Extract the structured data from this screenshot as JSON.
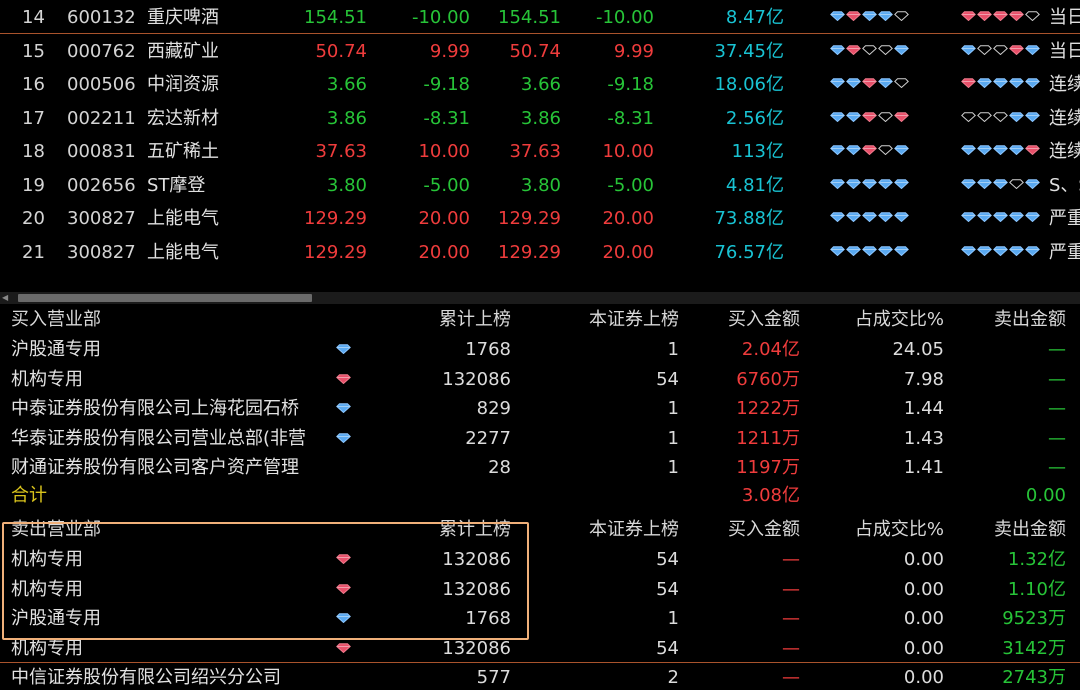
{
  "stock_rows": [
    {
      "idx": "14",
      "code": "600132",
      "name": "重庆啤酒",
      "v1": "154.51",
      "v2": "-10.00",
      "v3": "154.51",
      "v4": "-10.00",
      "dir": "green",
      "amount": "8.47亿",
      "d1": [
        "b",
        "r",
        "b",
        "b",
        "o"
      ],
      "d2": [
        "r",
        "r",
        "r",
        "r",
        "o"
      ],
      "note": "当日"
    },
    {
      "idx": "15",
      "code": "000762",
      "name": "西藏矿业",
      "v1": "50.74",
      "v2": "9.99",
      "v3": "50.74",
      "v4": "9.99",
      "dir": "red",
      "amount": "37.45亿",
      "d1": [
        "b",
        "r",
        "o",
        "o",
        "b"
      ],
      "d2": [
        "b",
        "o",
        "o",
        "r",
        "b"
      ],
      "note": "当日"
    },
    {
      "idx": "16",
      "code": "000506",
      "name": "中润资源",
      "v1": "3.66",
      "v2": "-9.18",
      "v3": "3.66",
      "v4": "-9.18",
      "dir": "green",
      "amount": "18.06亿",
      "d1": [
        "b",
        "b",
        "r",
        "b",
        "o"
      ],
      "d2": [
        "r",
        "b",
        "b",
        "b",
        "b"
      ],
      "note": "连续"
    },
    {
      "idx": "17",
      "code": "002211",
      "name": "宏达新材",
      "v1": "3.86",
      "v2": "-8.31",
      "v3": "3.86",
      "v4": "-8.31",
      "dir": "green",
      "amount": "2.56亿",
      "d1": [
        "b",
        "b",
        "r",
        "o",
        "r"
      ],
      "d2": [
        "o",
        "o",
        "o",
        "b",
        "b"
      ],
      "note": "连续"
    },
    {
      "idx": "18",
      "code": "000831",
      "name": "五矿稀土",
      "v1": "37.63",
      "v2": "10.00",
      "v3": "37.63",
      "v4": "10.00",
      "dir": "red",
      "amount": "113亿",
      "d1": [
        "b",
        "b",
        "r",
        "o",
        "b"
      ],
      "d2": [
        "b",
        "b",
        "b",
        "b",
        "r"
      ],
      "note": "连续"
    },
    {
      "idx": "19",
      "code": "002656",
      "name": "ST摩登",
      "v1": "3.80",
      "v2": "-5.00",
      "v3": "3.80",
      "v4": "-5.00",
      "dir": "green",
      "amount": "4.81亿",
      "d1": [
        "b",
        "b",
        "b",
        "b",
        "b"
      ],
      "d2": [
        "b",
        "b",
        "b",
        "o",
        "b"
      ],
      "note": "S、S"
    },
    {
      "idx": "20",
      "code": "300827",
      "name": "上能电气",
      "v1": "129.29",
      "v2": "20.00",
      "v3": "129.29",
      "v4": "20.00",
      "dir": "red",
      "amount": "73.88亿",
      "d1": [
        "b",
        "b",
        "b",
        "b",
        "b"
      ],
      "d2": [
        "b",
        "b",
        "b",
        "b",
        "b"
      ],
      "note": "严重"
    },
    {
      "idx": "21",
      "code": "300827",
      "name": "上能电气",
      "v1": "129.29",
      "v2": "20.00",
      "v3": "129.29",
      "v4": "20.00",
      "dir": "red",
      "amount": "76.57亿",
      "d1": [
        "b",
        "b",
        "b",
        "b",
        "b"
      ],
      "d2": [
        "b",
        "b",
        "b",
        "b",
        "b"
      ],
      "note": "严重"
    }
  ],
  "buy_header": {
    "name": "买入营业部",
    "cum": "累计上榜",
    "this": "本证券上榜",
    "buy": "买入金额",
    "ratio": "占成交比%",
    "sell": "卖出金额"
  },
  "buy_rows": [
    {
      "name": "沪股通专用",
      "dia": "b",
      "cum": "1768",
      "this": "1",
      "buy": "2.04亿",
      "ratio": "24.05",
      "sell": "—"
    },
    {
      "name": "机构专用",
      "dia": "r",
      "cum": "132086",
      "this": "54",
      "buy": "6760万",
      "ratio": "7.98",
      "sell": "—"
    },
    {
      "name": "中泰证券股份有限公司上海花园石桥",
      "dia": "b",
      "cum": "829",
      "this": "1",
      "buy": "1222万",
      "ratio": "1.44",
      "sell": "—"
    },
    {
      "name": "华泰证券股份有限公司营业总部(非营",
      "dia": "b",
      "cum": "2277",
      "this": "1",
      "buy": "1211万",
      "ratio": "1.43",
      "sell": "—"
    },
    {
      "name": "财通证券股份有限公司客户资产管理",
      "dia": "",
      "cum": "28",
      "this": "1",
      "buy": "1197万",
      "ratio": "1.41",
      "sell": "—"
    }
  ],
  "buy_total": {
    "label": "合计",
    "buy": "3.08亿",
    "sell": "0.00"
  },
  "sell_header": {
    "name": "卖出营业部",
    "cum": "累计上榜",
    "this": "本证券上榜",
    "buy": "买入金额",
    "ratio": "占成交比%",
    "sell": "卖出金额"
  },
  "sell_rows": [
    {
      "name": "机构专用",
      "dia": "r",
      "cum": "132086",
      "this": "54",
      "buy": "—",
      "ratio": "0.00",
      "sell": "1.32亿"
    },
    {
      "name": "机构专用",
      "dia": "r",
      "cum": "132086",
      "this": "54",
      "buy": "—",
      "ratio": "0.00",
      "sell": "1.10亿"
    },
    {
      "name": "沪股通专用",
      "dia": "b",
      "cum": "1768",
      "this": "1",
      "buy": "—",
      "ratio": "0.00",
      "sell": "9523万"
    },
    {
      "name": "机构专用",
      "dia": "r",
      "cum": "132086",
      "this": "54",
      "buy": "—",
      "ratio": "0.00",
      "sell": "3142万"
    },
    {
      "name": "中信证券股份有限公司绍兴分公司",
      "dia": "",
      "cum": "577",
      "this": "2",
      "buy": "—",
      "ratio": "0.00",
      "sell": "2743万"
    }
  ],
  "colors": {
    "up": "#ef3c3c",
    "down": "#27c438",
    "amount": "#19c3d3",
    "total": "#d9c31c",
    "highlight": "#f0b07a"
  }
}
